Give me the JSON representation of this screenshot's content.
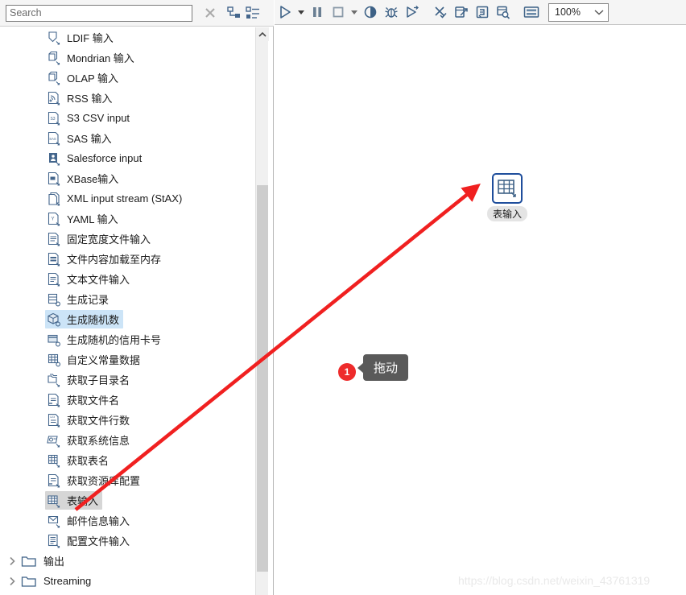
{
  "search": {
    "placeholder": "Search",
    "value": "",
    "clear_icon": "close-x-icon",
    "expand_all_icon": "expand-tree-icon",
    "collapse_all_icon": "collapse-tree-icon"
  },
  "toolbar": {
    "buttons": [
      {
        "name": "run-button",
        "icon": "play-icon"
      },
      {
        "name": "run-options-dropdown",
        "icon": "chevron-down-icon"
      },
      {
        "name": "pause-button",
        "icon": "pause-icon"
      },
      {
        "name": "stop-button",
        "icon": "stop-icon"
      },
      {
        "name": "stop-options-dropdown",
        "icon": "chevron-down-icon"
      },
      {
        "name": "preview-button",
        "icon": "preview-eye-icon"
      },
      {
        "name": "debug-button",
        "icon": "bug-icon"
      },
      {
        "name": "replay-button",
        "icon": "replay-play-icon"
      },
      {
        "name": "verify-button",
        "icon": "verify-check-icon"
      },
      {
        "name": "impact-analysis-button",
        "icon": "impact-arrow-icon"
      },
      {
        "name": "sql-button",
        "icon": "sql-script-icon"
      },
      {
        "name": "inspect-database-button",
        "icon": "database-search-icon"
      },
      {
        "name": "show-results-button",
        "icon": "grid-results-icon"
      }
    ],
    "zoom": {
      "value": "100%",
      "dropdown_icon": "chevron-down-icon"
    }
  },
  "tree": {
    "items": [
      {
        "label": "LDIF 输入",
        "icon": "ldif-input-icon",
        "state": "normal",
        "level": 2
      },
      {
        "label": "Mondrian 输入",
        "icon": "mondrian-input-icon",
        "state": "normal",
        "level": 2
      },
      {
        "label": "OLAP 输入",
        "icon": "olap-input-icon",
        "state": "normal",
        "level": 2
      },
      {
        "label": "RSS 输入",
        "icon": "rss-input-icon",
        "state": "normal",
        "level": 2
      },
      {
        "label": "S3 CSV input",
        "icon": "s3-csv-input-icon",
        "state": "normal",
        "level": 2
      },
      {
        "label": "SAS 输入",
        "icon": "sas-input-icon",
        "state": "normal",
        "level": 2
      },
      {
        "label": "Salesforce input",
        "icon": "salesforce-input-icon",
        "state": "normal",
        "level": 2
      },
      {
        "label": "XBase输入",
        "icon": "xbase-input-icon",
        "state": "normal",
        "level": 2
      },
      {
        "label": "XML input stream (StAX)",
        "icon": "xml-stax-input-icon",
        "state": "normal",
        "level": 2
      },
      {
        "label": "YAML 输入",
        "icon": "yaml-input-icon",
        "state": "normal",
        "level": 2
      },
      {
        "label": "固定宽度文件输入",
        "icon": "fixed-width-file-input-icon",
        "state": "normal",
        "level": 2
      },
      {
        "label": "文件内容加载至内存",
        "icon": "load-file-to-memory-icon",
        "state": "normal",
        "level": 2
      },
      {
        "label": "文本文件输入",
        "icon": "text-file-input-icon",
        "state": "normal",
        "level": 2
      },
      {
        "label": "生成记录",
        "icon": "generate-rows-icon",
        "state": "normal",
        "level": 2
      },
      {
        "label": "生成随机数",
        "icon": "generate-random-value-icon",
        "state": "hovered",
        "level": 2
      },
      {
        "label": "生成随机的信用卡号",
        "icon": "generate-random-creditcard-icon",
        "state": "normal",
        "level": 2
      },
      {
        "label": "自定义常量数据",
        "icon": "data-grid-icon",
        "state": "normal",
        "level": 2
      },
      {
        "label": "获取子目录名",
        "icon": "get-subfolder-names-icon",
        "state": "normal",
        "level": 2
      },
      {
        "label": "获取文件名",
        "icon": "get-file-names-icon",
        "state": "normal",
        "level": 2
      },
      {
        "label": "获取文件行数",
        "icon": "get-file-rowcount-icon",
        "state": "normal",
        "level": 2
      },
      {
        "label": "获取系统信息",
        "icon": "get-system-info-icon",
        "state": "normal",
        "level": 2
      },
      {
        "label": "获取表名",
        "icon": "get-table-names-icon",
        "state": "normal",
        "level": 2
      },
      {
        "label": "获取资源库配置",
        "icon": "get-repository-config-icon",
        "state": "normal",
        "level": 2
      },
      {
        "label": "表输入",
        "icon": "table-input-icon",
        "state": "selected",
        "level": 2
      },
      {
        "label": "邮件信息输入",
        "icon": "mail-input-icon",
        "state": "normal",
        "level": 2
      },
      {
        "label": "配置文件输入",
        "icon": "property-input-icon",
        "state": "normal",
        "level": 2
      },
      {
        "label": "输出",
        "icon": "folder-icon",
        "state": "folder",
        "level": 1,
        "expander": "chevron-right-icon"
      },
      {
        "label": "Streaming",
        "icon": "folder-icon",
        "state": "folder",
        "level": 1,
        "expander": "chevron-right-icon"
      }
    ]
  },
  "scrollbar": {
    "up_arrow_icon": "chevron-up-icon",
    "thumb_name": "vertical-scroll-thumb"
  },
  "canvas": {
    "step": {
      "label": "表输入",
      "icon": "table-input-step-icon",
      "border_color": "#1f4e9c"
    },
    "annotation": {
      "badge_number": "1",
      "callout_text": "拖动",
      "arrow_color": "#f02020"
    },
    "watermark": "https://blog.csdn.net/weixin_43761319"
  },
  "colors": {
    "icon_blue": "#44668c",
    "hover_blue": "#cce4f7",
    "selected_gray": "#d6d6d6",
    "badge_red": "#ee2b2b",
    "callout_gray": "#5a5a5a"
  }
}
